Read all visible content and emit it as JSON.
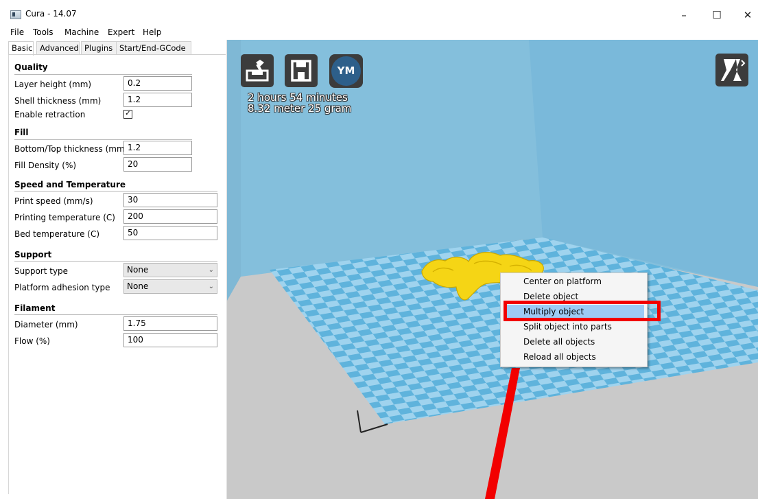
{
  "window": {
    "title": "Cura - 14.07",
    "minimize": "–",
    "maximize": "☐",
    "close": "✕"
  },
  "menubar": [
    "File",
    "Tools",
    "Machine",
    "Expert",
    "Help"
  ],
  "tabs": [
    "Basic",
    "Advanced",
    "Plugins",
    "Start/End-GCode"
  ],
  "quality": {
    "header": "Quality",
    "layer_height_label": "Layer height (mm)",
    "layer_height_value": "0.2",
    "shell_thickness_label": "Shell thickness (mm)",
    "shell_thickness_value": "1.2",
    "retraction_label": "Enable retraction",
    "retraction_checked": true,
    "retraction_mark": "✓"
  },
  "fill": {
    "header": "Fill",
    "bottom_top_label": "Bottom/Top thickness (mm)",
    "bottom_top_value": "1.2",
    "density_label": "Fill Density (%)",
    "density_value": "20"
  },
  "speed": {
    "header": "Speed and Temperature",
    "print_speed_label": "Print speed (mm/s)",
    "print_speed_value": "30",
    "print_temp_label": "Printing temperature (C)",
    "print_temp_value": "200",
    "bed_temp_label": "Bed temperature (C)",
    "bed_temp_value": "50"
  },
  "support": {
    "header": "Support",
    "type_label": "Support type",
    "type_value": "None",
    "adhesion_label": "Platform adhesion type",
    "adhesion_value": "None"
  },
  "filament": {
    "header": "Filament",
    "diameter_label": "Diameter (mm)",
    "diameter_value": "1.75",
    "flow_label": "Flow (%)",
    "flow_value": "100"
  },
  "toolbar": {
    "ym_label": "YM"
  },
  "print_info": {
    "time": "2 hours 54 minutes",
    "material": "8.32 meter 25 gram"
  },
  "context_menu": {
    "items": [
      "Center on platform",
      "Delete object",
      "Multiply object",
      "Split object into parts",
      "Delete all objects",
      "Reload all objects"
    ],
    "highlighted": "Multiply object"
  },
  "colors": {
    "sky": "#86c0dd",
    "model": "#f5d515",
    "tile_light": "#9fd3ee",
    "tile_dark": "#5fb3dc",
    "annotation": "#f20000",
    "highlight": "#9dcbf5"
  }
}
